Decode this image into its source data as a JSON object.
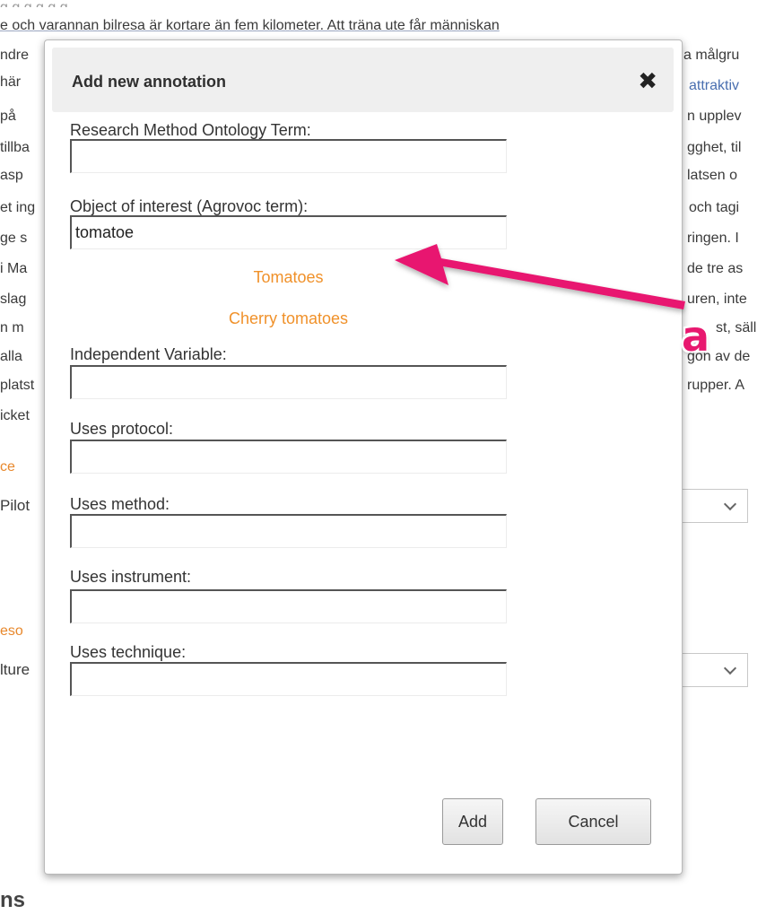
{
  "background": {
    "top_clipped": "g g g g g g",
    "top_line": "e och varannan bilresa är kortare än fem kilometer. Att träna ute får människan",
    "left_fragments": [
      "ndre",
      "här",
      "på",
      "tillba",
      "asp",
      "et ing",
      "ge s",
      "i Ma",
      "slag",
      "n m",
      "alla",
      "platst",
      "icket"
    ],
    "right_fragments": [
      "a målgru",
      "attraktiv",
      "n upplev",
      "gghet, til",
      "latsen o",
      "och tagi",
      "ringen. I",
      "de tre as",
      "uren, inte",
      "st, säll",
      "gon av de",
      "rupper. A"
    ],
    "orange_1": "ce",
    "select_1_fragment": "Pilot",
    "orange_2": "eso",
    "select_2_fragment": "lture",
    "heading_fragment": "ns"
  },
  "modal": {
    "title": "Add new annotation",
    "close_symbol": "✖",
    "fields": [
      {
        "label": "Research Method Ontology Term:",
        "value": ""
      },
      {
        "label": "Object of interest (Agrovoc term):",
        "value": "tomatoe"
      },
      {
        "label": "Independent Variable:",
        "value": ""
      },
      {
        "label": "Uses protocol:",
        "value": ""
      },
      {
        "label": "Uses method:",
        "value": ""
      },
      {
        "label": "Uses instrument:",
        "value": ""
      },
      {
        "label": "Uses technique:",
        "value": ""
      }
    ],
    "suggestions": [
      "Tomatoes",
      "Cherry tomatoes"
    ],
    "add_label": "Add",
    "cancel_label": "Cancel"
  },
  "annotation": {
    "letter": "a",
    "color": "#e8186f"
  }
}
